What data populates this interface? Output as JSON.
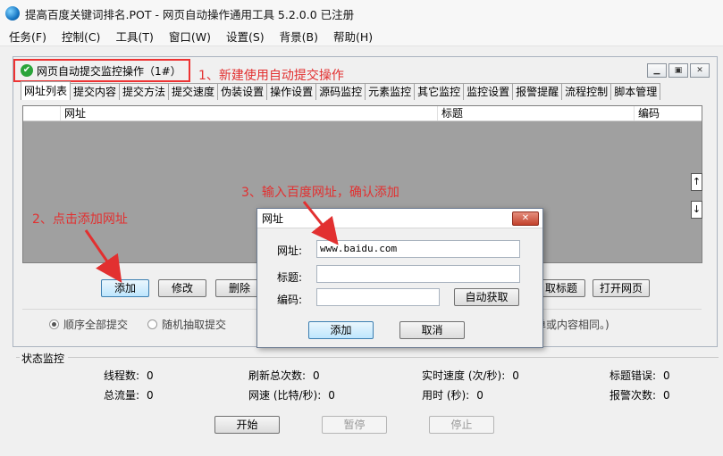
{
  "window": {
    "title": "提高百度关键词排名.POT  - 网页自动操作通用工具 5.2.0.0  已注册"
  },
  "menu": [
    {
      "label": "任务(F)"
    },
    {
      "label": "控制(C)"
    },
    {
      "label": "工具(T)"
    },
    {
      "label": "窗口(W)"
    },
    {
      "label": "设置(S)"
    },
    {
      "label": "背景(B)"
    },
    {
      "label": "帮助(H)"
    }
  ],
  "doc": {
    "title": "网页自动提交监控操作（1#）",
    "tabs": [
      {
        "label": "网址列表"
      },
      {
        "label": "提交内容"
      },
      {
        "label": "提交方法"
      },
      {
        "label": "提交速度"
      },
      {
        "label": "伪装设置"
      },
      {
        "label": "操作设置"
      },
      {
        "label": "源码监控"
      },
      {
        "label": "元素监控"
      },
      {
        "label": "其它监控"
      },
      {
        "label": "监控设置"
      },
      {
        "label": "报警提醒"
      },
      {
        "label": "流程控制"
      },
      {
        "label": "脚本管理"
      }
    ],
    "columns": [
      {
        "label": ""
      },
      {
        "label": "网址"
      },
      {
        "label": "标题"
      },
      {
        "label": "编码"
      }
    ],
    "buttons": {
      "add": "添加",
      "edit": "修改",
      "delete": "删除",
      "get_title": "取标题",
      "open_page": "打开网页"
    },
    "radios": [
      {
        "label": "顺序全部提交",
        "checked": true
      },
      {
        "label": "随机抽取提交",
        "checked": false
      }
    ],
    "partial_hint": "单或内容相同。)"
  },
  "status": {
    "legend": "状态监控",
    "items": [
      {
        "label": "线程数:",
        "value": "0"
      },
      {
        "label": "刷新总次数:",
        "value": "0"
      },
      {
        "label": "实时速度 (次/秒):",
        "value": "0"
      },
      {
        "label": "标题错误:",
        "value": "0"
      },
      {
        "label": "总流量:",
        "value": "0"
      },
      {
        "label": "网速 (比特/秒):",
        "value": "0"
      },
      {
        "label": "用时 (秒):",
        "value": "0"
      },
      {
        "label": "报警次数:",
        "value": "0"
      }
    ]
  },
  "controls": {
    "start": "开始",
    "pause": "暂停",
    "stop": "停止"
  },
  "dialog": {
    "title": "网址",
    "url_label": "网址:",
    "url_value": "www.baidu.com",
    "title_label": "标题:",
    "title_value": "",
    "encoding_label": "编码:",
    "encoding_value": "",
    "auto_button": "自动获取",
    "add_button": "添加",
    "cancel_button": "取消"
  },
  "annotations": {
    "step1": "1、新建使用自动提交操作",
    "step2": "2、点击添加网址",
    "step3": "3、输入百度网址，确认添加"
  },
  "colors": {
    "annotation": "#e23030",
    "highlight_border": "#ee3333"
  }
}
